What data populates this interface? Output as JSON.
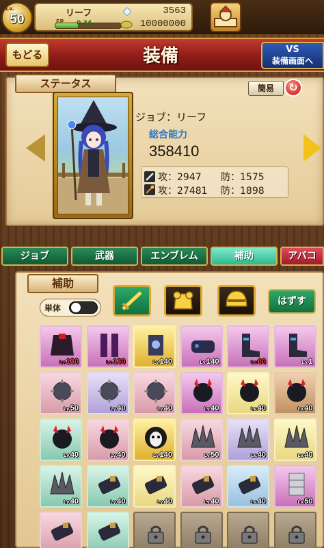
{
  "header": {
    "level_tag": "Lv.",
    "level": "50",
    "player_name": "リーフ",
    "exp_tag": "EP",
    "exp_text": "0.34",
    "exp_fraction": 0.34,
    "gems": "3563",
    "coins": "10000000"
  },
  "title_bar": {
    "back_label": "もどる",
    "title": "装備",
    "vs_line1": "VS",
    "vs_line2": "装備画面へ"
  },
  "status": {
    "section_label": "ステータス",
    "simple_label": "簡易",
    "job_text": "ジョブ：リーフ",
    "power_label": "総合能力",
    "power_value": "358410",
    "phys_atk": "攻：2947",
    "phys_def": "防：1575",
    "mag_atk": "攻：27481",
    "mag_def": "防：1898"
  },
  "tabs": [
    {
      "label": "ジョブ"
    },
    {
      "label": "武器"
    },
    {
      "label": "エンブレム"
    },
    {
      "label": "補助"
    },
    {
      "label": "アバコ"
    }
  ],
  "equip": {
    "section_label": "補助",
    "single_label": "単体",
    "remove_label": "はずす"
  },
  "items": [
    {
      "rarity": "r-purple",
      "icon": "dark-armor-icon",
      "lv": "130",
      "red": true
    },
    {
      "rarity": "r-purple",
      "icon": "leg-armor-icon",
      "lv": "130",
      "red": true
    },
    {
      "rarity": "r-gold",
      "icon": "armor-piece-icon",
      "lv": "140",
      "red": false
    },
    {
      "rarity": "r-purple",
      "icon": "gauntlet-icon",
      "lv": "140",
      "red": false
    },
    {
      "rarity": "r-purple",
      "icon": "boots-icon",
      "lv": "60",
      "red": true
    },
    {
      "rarity": "r-purple",
      "icon": "boots-icon",
      "lv": "1",
      "red": false
    },
    {
      "rarity": "r-pink",
      "icon": "spiked-ball-icon",
      "lv": "50",
      "red": false
    },
    {
      "rarity": "r-lav",
      "icon": "spiked-ball-icon",
      "lv": "40",
      "red": false
    },
    {
      "rarity": "r-pink",
      "icon": "spiked-ball-icon",
      "lv": "40",
      "red": false
    },
    {
      "rarity": "r-purple",
      "icon": "horned-helm-icon",
      "lv": "40",
      "red": false
    },
    {
      "rarity": "r-yellow",
      "icon": "horned-helm-icon",
      "lv": "40",
      "red": false
    },
    {
      "rarity": "r-brown",
      "icon": "horned-helm-icon",
      "lv": "40",
      "red": false
    },
    {
      "rarity": "r-green",
      "icon": "horned-helm-icon",
      "lv": "40",
      "red": false
    },
    {
      "rarity": "r-pink",
      "icon": "horned-helm-icon",
      "lv": "40",
      "red": false
    },
    {
      "rarity": "r-gold",
      "icon": "skull-mask-icon",
      "lv": "140",
      "red": false
    },
    {
      "rarity": "r-pink",
      "icon": "spiked-pauldron-icon",
      "lv": "50",
      "red": false
    },
    {
      "rarity": "r-lav",
      "icon": "spiked-pauldron-icon",
      "lv": "40",
      "red": false
    },
    {
      "rarity": "r-yellow",
      "icon": "spiked-pauldron-icon",
      "lv": "40",
      "red": false
    },
    {
      "rarity": "r-green",
      "icon": "spiked-pauldron-icon",
      "lv": "40",
      "red": false
    },
    {
      "rarity": "r-green",
      "icon": "arm-guard-icon",
      "lv": "40",
      "red": false
    },
    {
      "rarity": "r-yellow",
      "icon": "arm-guard-icon",
      "lv": "40",
      "red": false
    },
    {
      "rarity": "r-pink",
      "icon": "arm-guard-icon",
      "lv": "40",
      "red": false
    },
    {
      "rarity": "r-blue",
      "icon": "arm-guard-icon",
      "lv": "40",
      "red": false
    },
    {
      "rarity": "r-purple",
      "icon": "silver-armor-icon",
      "lv": "50",
      "red": false
    },
    {
      "rarity": "r-pink",
      "icon": "arm-guard-icon",
      "lv": "",
      "red": false
    },
    {
      "rarity": "r-green",
      "icon": "arm-guard-icon",
      "lv": "",
      "red": false
    },
    {
      "rarity": "locked",
      "icon": "lock-icon",
      "lv": "",
      "red": false
    },
    {
      "rarity": "locked",
      "icon": "lock-icon",
      "lv": "",
      "red": false
    },
    {
      "rarity": "locked",
      "icon": "lock-icon",
      "lv": "",
      "red": false
    },
    {
      "rarity": "locked",
      "icon": "lock-icon",
      "lv": "",
      "red": false
    }
  ],
  "colors": {
    "title_red": "#8e1c18",
    "tab_green": "#0e5a34",
    "tab_active": "#2cb892",
    "power_blue": "#2878c8",
    "gold": "#d8a832"
  }
}
